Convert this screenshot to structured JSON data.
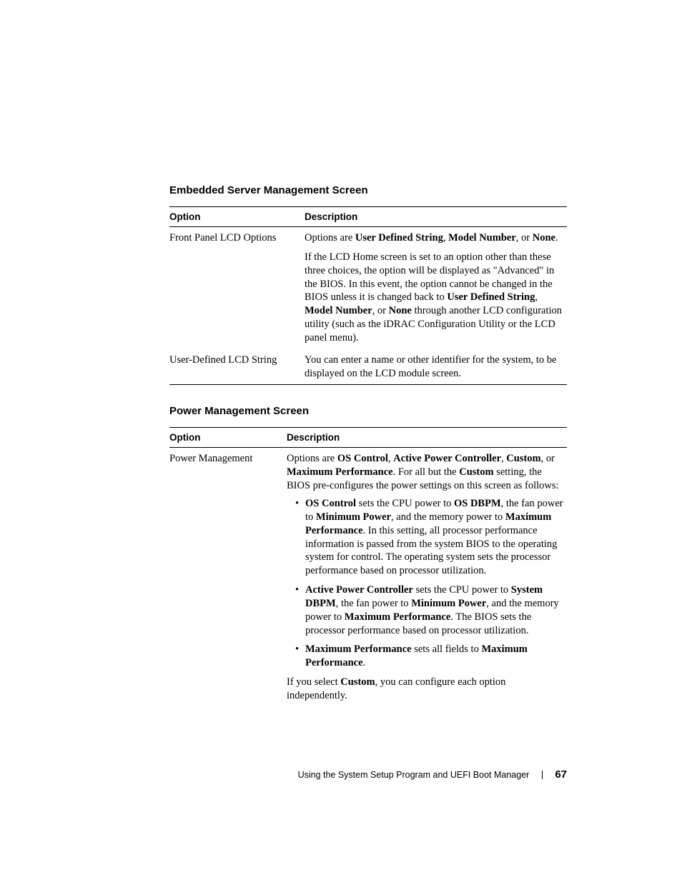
{
  "sections": {
    "embedded": {
      "heading": "Embedded Server Management Screen",
      "col_option": "Option",
      "col_description": "Description",
      "row1": {
        "option": "Front Panel LCD Options",
        "p1_a": "Options are ",
        "p1_b": "User Defined String",
        "p1_c": ", ",
        "p1_d": "Model Number",
        "p1_e": ", or ",
        "p1_f": "None",
        "p1_g": ".",
        "p2_a": "If the LCD Home screen is set to an option other than these three choices, the option will be displayed as \"Advanced\" in the BIOS. In this event, the option cannot be changed in the BIOS unless it is changed back to ",
        "p2_b": "User Defined String",
        "p2_c": ", ",
        "p2_d": "Model Number",
        "p2_e": ", or ",
        "p2_f": "None",
        "p2_g": " through another LCD configuration utility (such as the iDRAC Configuration Utility or the LCD panel menu)."
      },
      "row2": {
        "option": "User-Defined LCD String",
        "p1": "You can enter a name or other identifier for the system, to be displayed on the LCD module screen."
      }
    },
    "power": {
      "heading": "Power Management Screen",
      "col_option": "Option",
      "col_description": "Description",
      "row1": {
        "option": "Power Management",
        "intro_a": "Options are ",
        "intro_b": "OS Control",
        "intro_c": ", ",
        "intro_d": "Active Power Controller",
        "intro_e": ", ",
        "intro_f": "Custom",
        "intro_g": ", or ",
        "intro_h": "Maximum Performance",
        "intro_i": ". For all but the ",
        "intro_j": "Custom",
        "intro_k": " setting, the BIOS pre-configures the power settings on this screen as follows:",
        "b1_a": "OS Control",
        "b1_b": " sets the CPU power to ",
        "b1_c": "OS DBPM",
        "b1_d": ", the fan power to ",
        "b1_e": "Minimum Power",
        "b1_f": ", and the memory power to ",
        "b1_g": "Maximum Performance",
        "b1_h": ". In this setting, all processor performance information is passed from the system BIOS to the operating system for control. The operating system sets the processor performance based on processor utilization.",
        "b2_a": "Active Power Controller",
        "b2_b": " sets the CPU power to ",
        "b2_c": "System DBPM",
        "b2_d": ", the fan power to ",
        "b2_e": "Minimum Power",
        "b2_f": ", and the memory power to ",
        "b2_g": "Maximum Performance",
        "b2_h": ". The BIOS sets the processor performance based on processor utilization.",
        "b3_a": "Maximum Performance",
        "b3_b": " sets all fields to ",
        "b3_c": "Maximum Performance",
        "b3_d": ".",
        "outro_a": "If you select ",
        "outro_b": "Custom",
        "outro_c": ", you can configure each option independently."
      }
    }
  },
  "footer": {
    "text": "Using the System Setup Program and UEFI Boot Manager",
    "page": "67"
  }
}
